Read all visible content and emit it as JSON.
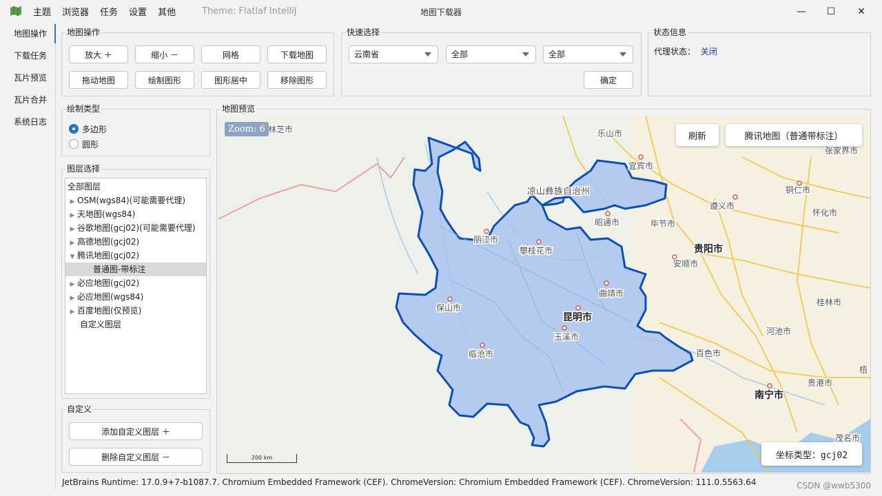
{
  "menu": [
    "主题",
    "浏览器",
    "任务",
    "设置",
    "其他"
  ],
  "theme_label": "Theme: Flatlaf IntelliJ",
  "window_title": "地图下载器",
  "window_controls": {
    "minimize": "—",
    "maximize": "☐",
    "close": "✕"
  },
  "nav": [
    "地图操作",
    "下载任务",
    "瓦片预览",
    "瓦片合并",
    "系统日志"
  ],
  "map_ops": {
    "title": "地图操作",
    "buttons": [
      "放大 ＋",
      "缩小 －",
      "网格",
      "下载地图",
      "拖动地图",
      "绘制图形",
      "图形居中",
      "移除图形"
    ]
  },
  "quick_select": {
    "title": "快速选择",
    "province": "云南省",
    "city": "全部",
    "district": "全部",
    "confirm": "确定"
  },
  "status_info": {
    "title": "状态信息",
    "proxy_label": "代理状态：",
    "proxy_value": "关闭"
  },
  "draw_type": {
    "title": "绘制类型",
    "options": [
      "多边形",
      "圆形"
    ],
    "selected": 0
  },
  "layers": {
    "title": "图层选择",
    "items": [
      "全部图层",
      "OSM(wgs84)(可能需要代理)",
      "天地图(wgs84)",
      "谷歌地图(gcj02)(可能需要代理)",
      "高德地图(gcj02)",
      "腾讯地图(gcj02)",
      "普通图-带标注",
      "必应地图(gcj02)",
      "必应地图(wgs84)",
      "百度地图(仅预览)",
      "自定义图层"
    ]
  },
  "custom": {
    "title": "自定义",
    "add": "添加自定义图层 ＋",
    "remove": "删除自定义图层 －"
  },
  "preview": {
    "title": "地图预览",
    "zoom": "Zoom: 6",
    "refresh": "刷新",
    "layer_name": "腾讯地图（普通带标注）",
    "coord_type": "坐标类型：gcj02",
    "scale": "200 km",
    "cities": [
      "林芝市",
      "乐山市",
      "宜宾市",
      "张家界市",
      "凉山彝族自治州",
      "铜仁市",
      "遵义市",
      "怀化市",
      "昭通市",
      "毕节市",
      "丽江市",
      "攀枝花市",
      "贵阳市",
      "安顺市",
      "曲靖市",
      "保山市",
      "昆明市",
      "玉溪市",
      "桂林市",
      "河池市",
      "临沧市",
      "百色市",
      "南宁市",
      "贵港市",
      "梧",
      "茂名市"
    ]
  },
  "status_bar": "JetBrains Runtime: 17.0.9+7-b1087.7. Chromium Embedded Framework (CEF). ChromeVersion: Chromium Embedded Framework (CEF). ChromeVersion: 111.0.5563.64",
  "watermark": "CSDN @wwb5300",
  "colors": {
    "accent": "#2675bf",
    "region_fill": "#a9c3ee",
    "region_stroke": "#0b4fb5",
    "road": "#f5c443",
    "land": "#eef0ea"
  }
}
